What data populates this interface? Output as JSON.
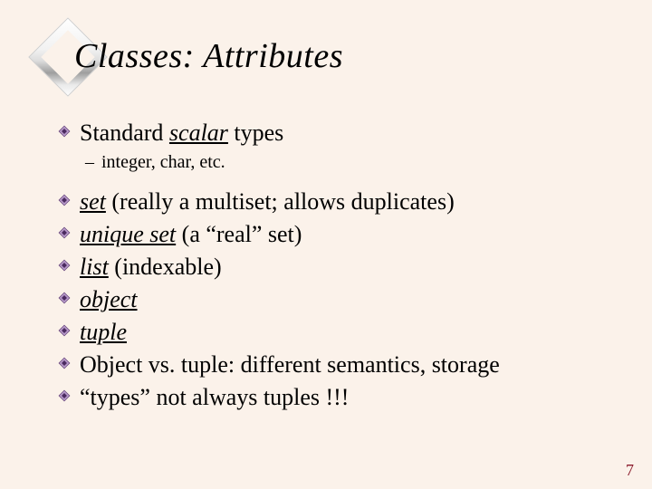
{
  "title": "Classes:  Attributes",
  "bullets": {
    "b0": {
      "pre": "Standard ",
      "u": "scalar",
      "post": " types"
    },
    "sub0": {
      "text": "integer, char, etc."
    },
    "b1": {
      "u": "set",
      "post": " (really a multiset; allows duplicates)"
    },
    "b2": {
      "u": "unique set",
      "post": " (a “real” set)"
    },
    "b3": {
      "u": "list",
      "post": " (indexable)"
    },
    "b4": {
      "u": "object"
    },
    "b5": {
      "u": "tuple"
    },
    "b6": {
      "plain": "Object vs. tuple:  different semantics, storage"
    },
    "b7": {
      "plain": "“types” not always tuples !!!"
    }
  },
  "page_number": "7"
}
